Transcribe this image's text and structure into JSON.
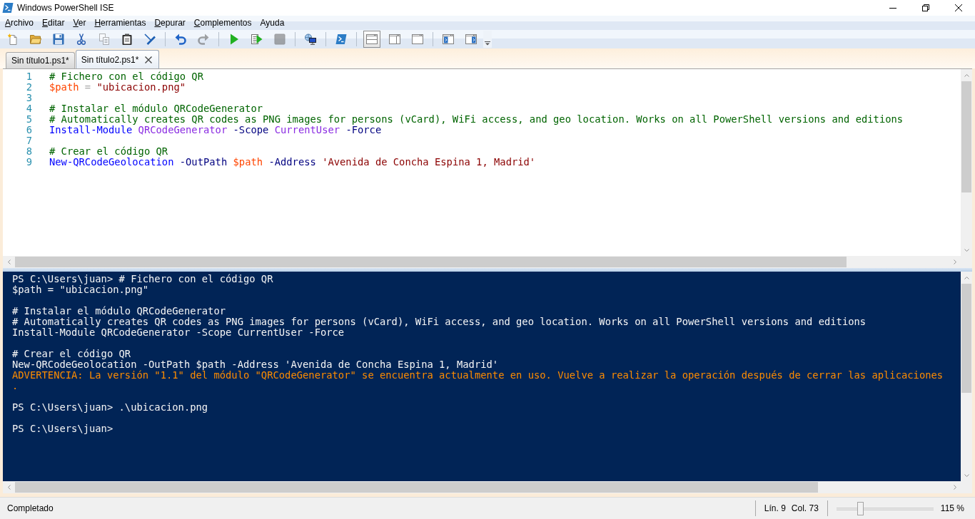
{
  "window": {
    "title": "Windows PowerShell ISE"
  },
  "menu": [
    {
      "label": "Archivo",
      "mnemonic": true
    },
    {
      "label": "Editar",
      "mnemonic": true
    },
    {
      "label": "Ver",
      "mnemonic": true
    },
    {
      "label": "Herramientas",
      "mnemonic": true
    },
    {
      "label": "Depurar",
      "mnemonic": true
    },
    {
      "label": "Complementos",
      "mnemonic": true
    },
    {
      "label": "Ayuda",
      "mnemonic": false
    }
  ],
  "toolbar": {
    "groups": [
      {
        "buttons": [
          {
            "kind": "new",
            "disabled": false
          },
          {
            "kind": "open",
            "disabled": false
          },
          {
            "kind": "save",
            "disabled": false
          },
          {
            "kind": "cut",
            "disabled": false
          },
          {
            "kind": "copy",
            "disabled": true
          },
          {
            "kind": "paste",
            "disabled": false
          },
          {
            "kind": "clear",
            "disabled": false
          }
        ]
      },
      {
        "buttons": [
          {
            "kind": "undo",
            "disabled": false
          },
          {
            "kind": "redo",
            "disabled": true
          }
        ]
      },
      {
        "buttons": [
          {
            "kind": "run",
            "disabled": false
          },
          {
            "kind": "runselection",
            "disabled": false
          },
          {
            "kind": "stop",
            "disabled": true
          }
        ]
      },
      {
        "buttons": [
          {
            "kind": "remote",
            "disabled": false
          }
        ]
      },
      {
        "buttons": [
          {
            "kind": "console",
            "disabled": false
          }
        ]
      },
      {
        "buttons": [
          {
            "kind": "layouttop",
            "selected": true
          },
          {
            "kind": "layoutright",
            "selected": false
          },
          {
            "kind": "layoutmax",
            "selected": false
          }
        ]
      },
      {
        "buttons": [
          {
            "kind": "commands",
            "disabled": false
          },
          {
            "kind": "addons",
            "disabled": false
          }
        ]
      }
    ]
  },
  "tabs": [
    {
      "label": "Sin título1.ps1*",
      "selected": false
    },
    {
      "label": "Sin título2.ps1*",
      "selected": true
    }
  ],
  "editor": {
    "lines": [
      {
        "number": "1",
        "tokens": [
          {
            "kind": "comment",
            "text": "# Fichero con el código QR"
          }
        ]
      },
      {
        "number": "2",
        "tokens": [
          {
            "kind": "variable",
            "text": "$path"
          },
          {
            "kind": "operator",
            "text": "="
          },
          {
            "kind": "string",
            "text": "\"ubicacion.png\""
          }
        ]
      },
      {
        "number": "3"
      },
      {
        "number": "4",
        "tokens": [
          {
            "kind": "comment",
            "text": "# Instalar el módulo QRCodeGenerator"
          }
        ]
      },
      {
        "number": "5",
        "tokens": [
          {
            "kind": "comment",
            "text": "# Automatically creates QR codes as PNG images for persons (vCard), WiFi access, and geo location. Works on all PowerShell versions and editions"
          }
        ]
      },
      {
        "number": "6",
        "tokens": [
          {
            "kind": "command",
            "text": "Install-Module"
          },
          {
            "kind": "argument",
            "text": "QRCodeGenerator"
          },
          {
            "kind": "parameter",
            "text": "-Scope"
          },
          {
            "kind": "argument",
            "text": "CurrentUser"
          },
          {
            "kind": "parameter",
            "text": "-Force"
          }
        ]
      },
      {
        "number": "7"
      },
      {
        "number": "8",
        "tokens": [
          {
            "kind": "comment",
            "text": "# Crear el código QR"
          }
        ]
      },
      {
        "number": "9",
        "tokens": [
          {
            "kind": "command",
            "text": "New-QRCodeGeolocation"
          },
          {
            "kind": "parameter",
            "text": "-OutPath"
          },
          {
            "kind": "variable",
            "text": "$path"
          },
          {
            "kind": "parameter",
            "text": "-Address"
          },
          {
            "kind": "string",
            "text": "'Avenida de Concha Espina 1, Madrid'"
          }
        ]
      }
    ]
  },
  "console": {
    "lines": [
      {
        "kind": "normal",
        "text": "PS C:\\Users\\juan> # Fichero con el código QR"
      },
      {
        "kind": "normal",
        "text": "$path = \"ubicacion.png\""
      },
      {
        "kind": "blank"
      },
      {
        "kind": "normal",
        "text": "# Instalar el módulo QRCodeGenerator"
      },
      {
        "kind": "normal",
        "text": "# Automatically creates QR codes as PNG images for persons (vCard), WiFi access, and geo location. Works on all PowerShell versions and editions"
      },
      {
        "kind": "normal",
        "text": "Install-Module QRCodeGenerator -Scope CurrentUser -Force"
      },
      {
        "kind": "blank"
      },
      {
        "kind": "normal",
        "text": "# Crear el código QR"
      },
      {
        "kind": "normal",
        "text": "New-QRCodeGeolocation -OutPath $path -Address 'Avenida de Concha Espina 1, Madrid'"
      },
      {
        "kind": "warning",
        "text": "ADVERTENCIA: La versión \"1.1\" del módulo \"QRCodeGenerator\" se encuentra actualmente en uso. Vuelve a realizar la operación después de cerrar las aplicaciones"
      },
      {
        "kind": "warning",
        "text": "."
      },
      {
        "kind": "blank"
      },
      {
        "kind": "normal",
        "text": "PS C:\\Users\\juan> .\\ubicacion.png"
      },
      {
        "kind": "blank"
      },
      {
        "kind": "normal",
        "text": "PS C:\\Users\\juan>"
      }
    ]
  },
  "status_bar": {
    "message": "Completado",
    "line": "Lín. 9",
    "column": "Col. 73",
    "zoom": {
      "level": 0.25,
      "reading": "115 %"
    }
  }
}
